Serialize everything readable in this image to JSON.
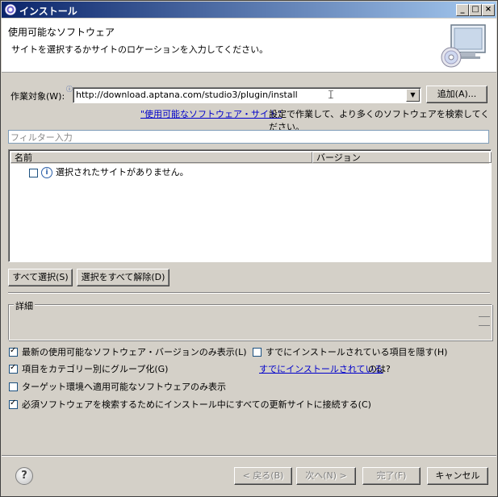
{
  "window": {
    "title": "インストール",
    "controls": [
      "_",
      "□",
      "×"
    ]
  },
  "header": {
    "title": "使用可能なソフトウェア",
    "subtitle": "サイトを選択するかサイトのロケーションを入力してください。"
  },
  "work_with": {
    "label": "作業対象(W):",
    "value": "http://download.aptana.com/studio3/plugin/install",
    "add_button": "追加(A)..."
  },
  "hint": {
    "link": "\"使用可能なソフトウェア・サイト\"",
    "text": "設定で作業して、より多くのソフトウェアを検索してください。"
  },
  "filter": {
    "placeholder": "フィルター入力"
  },
  "table": {
    "columns": [
      "名前",
      "バージョン"
    ],
    "rows": [
      {
        "name": "選択されたサイトがありません。"
      }
    ]
  },
  "selection_buttons": {
    "select_all": "すべて選択(S)",
    "deselect_all": "選択をすべて解除(D)"
  },
  "details": {
    "label": "詳細"
  },
  "options": {
    "latest_only": {
      "label": "最新の使用可能なソフトウェア・バージョンのみ表示(L)",
      "checked": true
    },
    "group_by_category": {
      "label": "項目をカテゴリー別にグループ化(G)",
      "checked": true
    },
    "target_env_only": {
      "label": "ターゲット環境へ適用可能なソフトウェアのみ表示",
      "checked": false
    },
    "contact_all_sites": {
      "label": "必須ソフトウェアを検索するためにインストール中にすべての更新サイトに接続する(C)",
      "checked": true
    },
    "hide_installed": {
      "label": "すでにインストールされている項目を隠す(H)",
      "checked": false
    },
    "already_installed_link": "すでにインストールされている",
    "already_installed_suffix": "のは?"
  },
  "footer": {
    "back": "< 戻る(B)",
    "next": "次へ(N) >",
    "finish": "完了(F)",
    "cancel": "キャンセル"
  },
  "colors": {
    "titlebar_start": "#0a246a",
    "titlebar_end": "#a6caf0",
    "link": "#0000cc",
    "dialog_bg": "#d4d0c8"
  }
}
